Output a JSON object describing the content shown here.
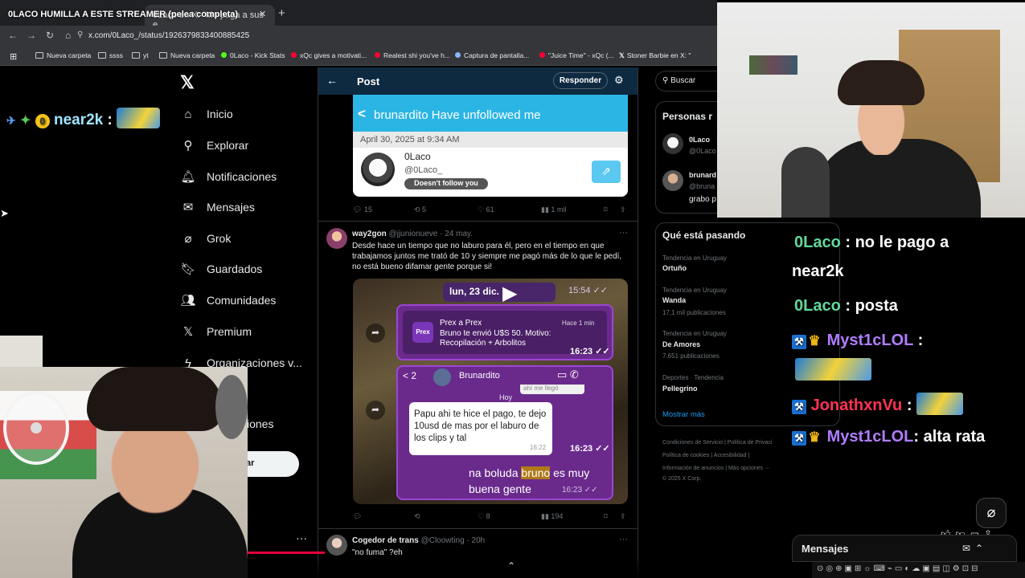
{
  "video_title": "0LACO HUMILLA A ESTE STREAMER (pelea completa)",
  "browser": {
    "active_tab": "0Laco en X: \"Me paga a sus e",
    "url": "x.com/0Laco_/status/1926379833400885425",
    "bookmarks": [
      "Nueva carpeta",
      "ssss",
      "yt",
      "Nueva carpeta",
      "0Laco - Kick Stats",
      "xQc gives a motivati...",
      "Realest shi you've h...",
      "Captura de pantalla...",
      "\"Juice Time\" - xQc (...",
      "Stoner Barbie en X: \""
    ]
  },
  "sidebar": {
    "items": [
      {
        "label": "Inicio",
        "icon": "home-icon"
      },
      {
        "label": "Explorar",
        "icon": "search-icon"
      },
      {
        "label": "Notificaciones",
        "icon": "bell-icon"
      },
      {
        "label": "Mensajes",
        "icon": "mail-icon"
      },
      {
        "label": "Grok",
        "icon": "grok-icon"
      },
      {
        "label": "Guardados",
        "icon": "bookmark-icon"
      },
      {
        "label": "Comunidades",
        "icon": "communities-icon"
      },
      {
        "label": "Premium",
        "icon": "x-icon"
      },
      {
        "label": "Organizaciones v...",
        "icon": "lightning-icon"
      }
    ],
    "partial_item": "iones",
    "post_button_partial": "ar",
    "more": "···"
  },
  "chat_left": {
    "user": "near2k",
    "sep": ":"
  },
  "post": {
    "header": "Post",
    "reply_label": "Responder",
    "card": {
      "back": "<",
      "title": "brunardito  Have unfollowed me",
      "date": "April 30, 2025 at 9:34 AM",
      "user": "0Laco",
      "handle": "@0Laco_",
      "follow_status": "Doesn't follow you"
    },
    "stats": {
      "replies": "15",
      "reposts": "5",
      "likes": "61",
      "views": "1 mil"
    },
    "reply": {
      "name": "way2gon",
      "handle": "@jjunionueve",
      "date": "· 24 may.",
      "text": "Desde hace un tiempo que no laburo para él, pero en el tiempo en que trabajamos juntos me trató de 10 y siempre me pagó más de lo que le pedí, no está bueno difamar gente porque si!",
      "more": "···",
      "image": {
        "date_chip": "lun, 23 dic.",
        "time_top": "15:54 ✓✓",
        "prex_title": "Prex a Prex",
        "prex_ago": "Hace 1 min",
        "prex_msg": "Bruno te envió U$S 50. Motivo: Recopilación + Arbolitos",
        "prex_time": "16:23 ✓✓",
        "chat_back": "< 2",
        "chat_name": "Brunardito",
        "day": "Hoy",
        "received": "Papu ahi te hice el pago, te dejo 10usd de mas por el laburo de los clips y tal",
        "received_time": "16:22",
        "received_status": "16:23 ✓✓",
        "sent_pre": "na boluda ",
        "sent_hl": "bruno",
        "sent_post": " es muy buena gente",
        "sent_time": "16:23 ✓✓",
        "quoted_partial": "ahí me llegó"
      },
      "stats": {
        "reposts": "",
        "likes": "8",
        "views": "194"
      }
    },
    "next_tweet": {
      "name": "Cogedor de trans",
      "handle": "@Cloowting",
      "date": "· 20h",
      "text": "\"no fuma\" ?eh",
      "more": "···"
    }
  },
  "right": {
    "search_placeholder": "Buscar",
    "personas_title": "Personas r",
    "personas": [
      {
        "name": "0Laco",
        "handle": "@0Laco"
      },
      {
        "name": "brunard",
        "handle": "@bruna",
        "bio": "grabo p"
      }
    ],
    "trends_title": "Qué está pasando",
    "trends": [
      {
        "label": "Tendencia en Uruguay",
        "name": "Ortuño",
        "count": ""
      },
      {
        "label": "Tendencia en Uruguay",
        "name": "Wanda",
        "count": "17,1 mil publicaciones"
      },
      {
        "label": "Tendencia en Uruguay",
        "name": "De Amores",
        "count": "7.651 publicaciones"
      },
      {
        "label": "Deportes · Tendencia",
        "name": "Pellegrino",
        "count": ""
      }
    ],
    "show_more": "Mostrar más",
    "footer": [
      "Condiciones de Servicio  |  Política de Privaci",
      "Política de cookies  |  Accesibilidad  |",
      "Información de anuncios  |  Más opciones ···",
      "© 2025 X Corp."
    ],
    "messages": "Mensajes"
  },
  "chat_right": [
    {
      "user": "0Laco",
      "text": ": no le pago a",
      "cont": "near2k"
    },
    {
      "user": "0Laco",
      "text": ": posta"
    },
    {
      "user": "Myst1cLOL",
      "text": ":"
    },
    {
      "user": "JonathxnVu",
      "text": ":"
    },
    {
      "user": "Myst1cLOL",
      "text": ": alta rata"
    }
  ]
}
